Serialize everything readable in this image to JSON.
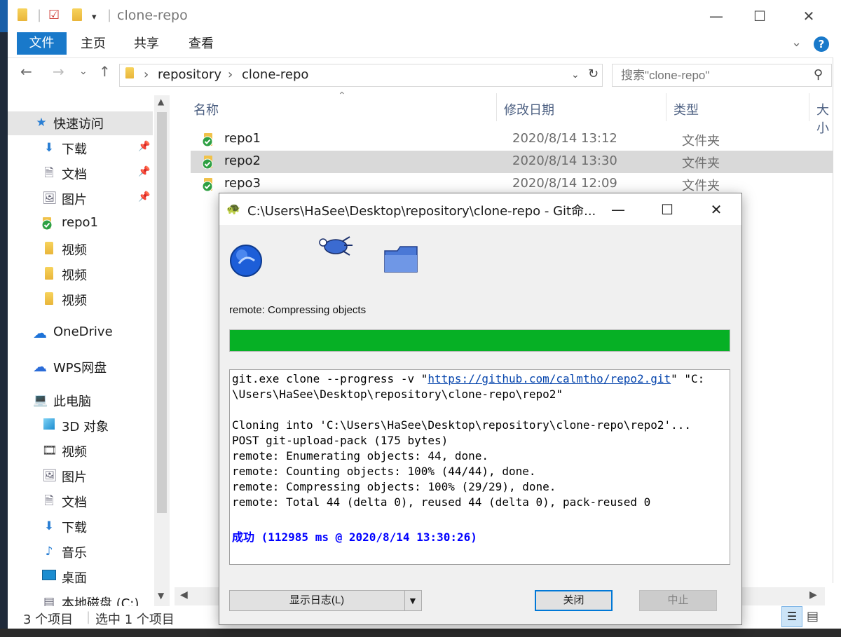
{
  "explorer": {
    "title": "clone-repo",
    "ribbon_tabs": [
      "文件",
      "主页",
      "共享",
      "查看"
    ],
    "help_label": "?",
    "breadcrumb": [
      "repository",
      "clone-repo"
    ],
    "search_placeholder": "搜索\"clone-repo\"",
    "nav": {
      "quick_access": "快速访问",
      "items": [
        {
          "label": "下载",
          "icon": "download-icon",
          "pinned": true
        },
        {
          "label": "文档",
          "icon": "document-icon",
          "pinned": true
        },
        {
          "label": "图片",
          "icon": "picture-icon",
          "pinned": true
        },
        {
          "label": "repo1",
          "icon": "git-folder-icon",
          "pinned": false
        },
        {
          "label": "视频",
          "icon": "folder-icon",
          "pinned": false
        },
        {
          "label": "视频",
          "icon": "folder-icon",
          "pinned": false
        },
        {
          "label": "视频",
          "icon": "folder-icon",
          "pinned": false
        }
      ],
      "onedrive": "OneDrive",
      "wps": "WPS网盘",
      "this_pc": "此电脑",
      "pc_items": [
        {
          "label": "3D 对象",
          "icon": "cube-icon"
        },
        {
          "label": "视频",
          "icon": "video-icon"
        },
        {
          "label": "图片",
          "icon": "picture-icon"
        },
        {
          "label": "文档",
          "icon": "document-icon"
        },
        {
          "label": "下载",
          "icon": "download-icon"
        },
        {
          "label": "音乐",
          "icon": "music-icon"
        },
        {
          "label": "桌面",
          "icon": "desktop-icon"
        },
        {
          "label": "本地磁盘 (C:)",
          "icon": "drive-icon"
        }
      ]
    },
    "columns": {
      "name": "名称",
      "date": "修改日期",
      "type": "类型",
      "size": "大小"
    },
    "files": [
      {
        "name": "repo1",
        "date": "2020/8/14 13:12",
        "type": "文件夹",
        "selected": false
      },
      {
        "name": "repo2",
        "date": "2020/8/14 13:30",
        "type": "文件夹",
        "selected": true
      },
      {
        "name": "repo3",
        "date": "2020/8/14 12:09",
        "type": "文件夹",
        "selected": false
      }
    ],
    "status": {
      "count": "3 个项目",
      "selected": "选中 1 个项目"
    }
  },
  "dialog": {
    "title": "C:\\Users\\HaSee\\Desktop\\repository\\clone-repo - Git命...",
    "status": "remote: Compressing objects",
    "progress": 1.0,
    "log": {
      "cmd_prefix": "git.exe clone --progress -v \"",
      "cmd_url": "https://github.com/calmtho/repo2.git",
      "cmd_suffix": "\" \"C:",
      "cmd_line2": "\\Users\\HaSee\\Desktop\\repository\\clone-repo\\repo2\"",
      "lines": [
        "Cloning into 'C:\\Users\\HaSee\\Desktop\\repository\\clone-repo\\repo2'...",
        "POST git-upload-pack (175 bytes)",
        "remote: Enumerating objects: 44, done.",
        "remote: Counting objects: 100% (44/44), done.",
        "remote: Compressing objects: 100% (29/29), done.",
        "remote: Total 44 (delta 0), reused 44 (delta 0), pack-reused 0"
      ],
      "success": "成功 (112985 ms @ 2020/8/14 13:30:26)"
    },
    "buttons": {
      "show_log": "显示日志(L)",
      "close": "关闭",
      "abort": "中止"
    }
  },
  "colors": {
    "accent": "#1979ca",
    "progress": "#06b025",
    "selection": "#d9d9d9",
    "success_text": "#0000ff"
  }
}
